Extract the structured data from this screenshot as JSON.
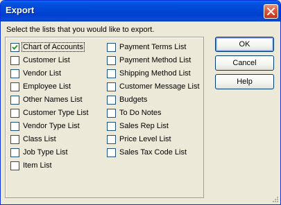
{
  "window": {
    "title": "Export"
  },
  "dialog": {
    "prompt": "Select the lists that you would like to export."
  },
  "left_column": [
    {
      "label": "Chart of Accounts",
      "checked": true
    },
    {
      "label": "Customer List",
      "checked": false
    },
    {
      "label": "Vendor List",
      "checked": false
    },
    {
      "label": "Employee List",
      "checked": false
    },
    {
      "label": "Other Names List",
      "checked": false
    },
    {
      "label": "Customer Type List",
      "checked": false
    },
    {
      "label": "Vendor Type List",
      "checked": false
    },
    {
      "label": "Class List",
      "checked": false
    },
    {
      "label": "Job Type List",
      "checked": false
    },
    {
      "label": "Item List",
      "checked": false
    }
  ],
  "right_column": [
    {
      "label": "Payment Terms List",
      "checked": false
    },
    {
      "label": "Payment Method List",
      "checked": false
    },
    {
      "label": "Shipping Method List",
      "checked": false
    },
    {
      "label": "Customer Message List",
      "checked": false
    },
    {
      "label": "Budgets",
      "checked": false
    },
    {
      "label": "To Do Notes",
      "checked": false
    },
    {
      "label": "Sales Rep List",
      "checked": false
    },
    {
      "label": "Price Level List",
      "checked": false
    },
    {
      "label": "Sales Tax Code List",
      "checked": false
    }
  ],
  "buttons": {
    "ok": "OK",
    "cancel": "Cancel",
    "help": "Help"
  },
  "colors": {
    "titlebar": "#0148d8",
    "dialog_bg": "#ece9d8",
    "close_button": "#d8563a"
  }
}
